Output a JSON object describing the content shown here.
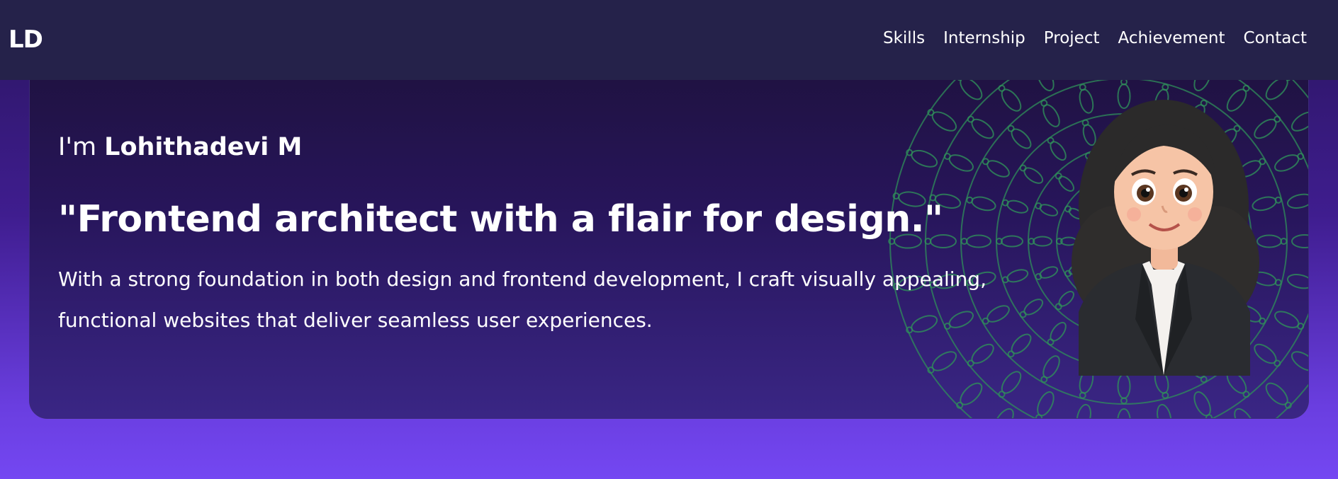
{
  "nav": {
    "logo": "LD",
    "links": [
      {
        "label": "Skills"
      },
      {
        "label": "Internship"
      },
      {
        "label": "Project"
      },
      {
        "label": "Achievement"
      },
      {
        "label": "Contact"
      }
    ]
  },
  "hero": {
    "greeting_prefix": "I'm ",
    "name": "Lohithadevi M",
    "tagline": "\"Frontend architect with a flair for design.\"",
    "description": "With a strong foundation in both design and frontend development, I craft visually appealing, functional websites that deliver seamless user experiences."
  },
  "colors": {
    "navbar_bg": "#25224a",
    "card_bg": "#1f1240",
    "page_gradient_end": "#7447f2",
    "mandala_green": "#2f8f5a",
    "text": "#ffffff"
  },
  "icons": {
    "avatar": "avatar-illustration",
    "decoration": "mandala-pattern"
  }
}
